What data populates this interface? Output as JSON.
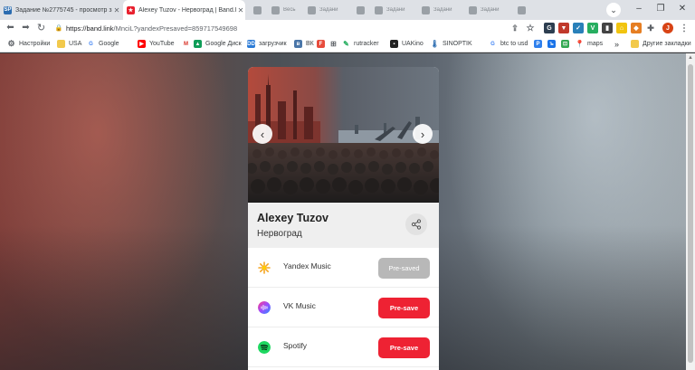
{
  "tabs": [
    {
      "title": "Задание №2775745 - просмотр з",
      "icon": "sp-logo-icon",
      "active": false
    },
    {
      "title": "Alexey Tuzov - Нервоград | Band.l",
      "icon": "bandlink-icon",
      "active": true
    },
    {
      "title": "",
      "icon": "tab-icon",
      "active": false
    },
    {
      "title": "Весь",
      "icon": "tab-icon",
      "active": false
    },
    {
      "title": "Задани",
      "icon": "tab-icon",
      "active": false
    },
    {
      "title": "",
      "icon": "tab-icon",
      "active": false
    },
    {
      "title": "Задани",
      "icon": "tab-icon",
      "active": false
    },
    {
      "title": "Задани",
      "icon": "tab-icon",
      "active": false
    },
    {
      "title": "Задани",
      "icon": "tab-icon",
      "active": false
    },
    {
      "title": "",
      "icon": "tab-icon",
      "active": false
    }
  ],
  "address_bar": {
    "host": "https://band.link",
    "path": "/MnciL?yandexPresaved=859717549698"
  },
  "bookmarks": [
    {
      "label": "Настройки",
      "icon": "gear-icon"
    },
    {
      "label": "USA",
      "icon": "folder-icon"
    },
    {
      "label": "Google",
      "icon": "google-icon"
    },
    {
      "label": "YouTube",
      "icon": "youtube-icon"
    },
    {
      "label": "",
      "icon": "gmail-icon"
    },
    {
      "label": "Google Диск",
      "icon": "google-drive-icon"
    },
    {
      "label": "загрузчик",
      "icon": "downloader-icon"
    },
    {
      "label": "ВК",
      "icon": "vk-icon"
    },
    {
      "label": "",
      "icon": "bookmark-icon"
    },
    {
      "label": "",
      "icon": "bookmark-icon"
    },
    {
      "label": "rutracker",
      "icon": "rutracker-icon"
    },
    {
      "label": "UAKino",
      "icon": "uakino-icon"
    },
    {
      "label": "SINOPTIK",
      "icon": "thermometer-icon"
    },
    {
      "label": "btc to usd",
      "icon": "google-icon"
    },
    {
      "label": "",
      "icon": "bookmark-icon"
    },
    {
      "label": "",
      "icon": "bookmark-icon"
    },
    {
      "label": "",
      "icon": "bookmark-icon"
    },
    {
      "label": "maps",
      "icon": "maps-icon"
    }
  ],
  "bookmarks_more": "»",
  "bookmarks_other": "Другие закладки",
  "card": {
    "artist": "Alexey Tuzov",
    "release": "Нервоград",
    "services": [
      {
        "name": "Yandex Music",
        "button": "Pre-saved",
        "state": "done",
        "icon": "yandex-music-icon"
      },
      {
        "name": "VK Music",
        "button": "Pre-save",
        "state": "action",
        "icon": "vk-music-icon"
      },
      {
        "name": "Spotify",
        "button": "Pre-save",
        "state": "action",
        "icon": "spotify-icon"
      }
    ]
  },
  "colors": {
    "presave_red": "#ee2233",
    "presaved_grey": "#b8b8b8",
    "card_header_bg": "#efefef"
  }
}
